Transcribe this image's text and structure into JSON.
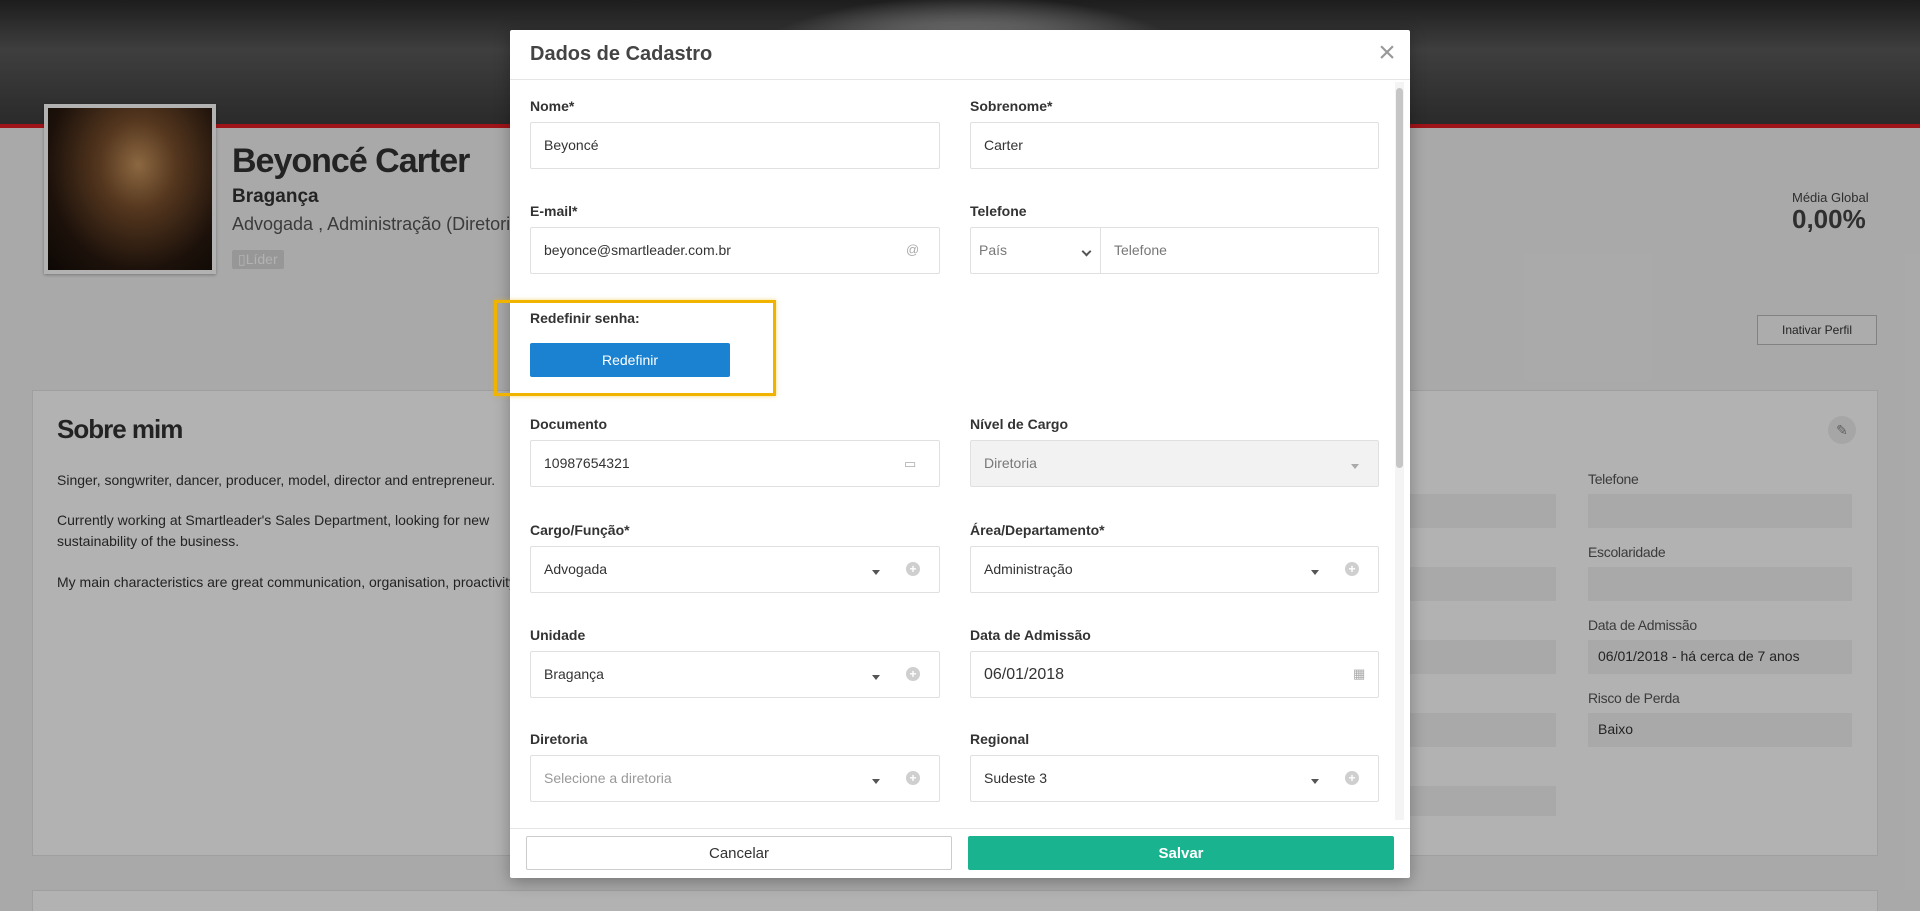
{
  "profile": {
    "name": "Beyoncé Carter",
    "unit": "Bragança",
    "role": "Advogada , Administração (Diretoria)",
    "badge": "Líder",
    "media_label": "Média Global",
    "media_value": "0,00%",
    "inativar_label": "Inativar Perfil"
  },
  "about": {
    "title": "Sobre mim",
    "p1": "Singer, songwriter, dancer, producer, model, director and entrepreneur.",
    "p2a": "Currently working at Smartleader's Sales Department, looking for new",
    "p2b": "sustainability of the business.",
    "p3": "My main characteristics are great communication, organisation, proactivity"
  },
  "right_fields": [
    {
      "label": "Telefone",
      "value": ""
    },
    {
      "label": "Escolaridade",
      "value": ""
    },
    {
      "label": "Data de Admissão",
      "value": "06/01/2018  -  há cerca de 7 anos"
    },
    {
      "label": "Risco de Perda",
      "value": "Baixo"
    }
  ],
  "modal": {
    "title": "Dados de Cadastro",
    "close_icon": "×",
    "fields": {
      "nome": {
        "label": "Nome*",
        "value": "Beyoncé"
      },
      "sobrenome": {
        "label": "Sobrenome*",
        "value": "Carter"
      },
      "email": {
        "label": "E-mail*",
        "value": "beyonce@smartleader.com.br"
      },
      "telefone": {
        "label": "Telefone",
        "country_placeholder": "País",
        "placeholder": "Telefone"
      },
      "redefinir": {
        "label": "Redefinir senha:",
        "button": "Redefinir"
      },
      "documento": {
        "label": "Documento",
        "value": "10987654321"
      },
      "nivel": {
        "label": "Nível de Cargo",
        "value": "Diretoria"
      },
      "cargo": {
        "label": "Cargo/Função*",
        "value": "Advogada"
      },
      "area": {
        "label": "Área/Departamento*",
        "value": "Administração"
      },
      "unidade": {
        "label": "Unidade",
        "value": "Bragança"
      },
      "admissao": {
        "label": "Data de Admissão",
        "value": "06/01/2018"
      },
      "diretoria": {
        "label": "Diretoria",
        "placeholder": "Selecione a diretoria"
      },
      "regional": {
        "label": "Regional",
        "value": "Sudeste 3"
      }
    },
    "cancel_label": "Cancelar",
    "save_label": "Salvar"
  },
  "colors": {
    "accent_red": "#e31e24",
    "primary_blue": "#1b82d1",
    "save_green": "#1ab38f",
    "highlight": "#f0b400"
  }
}
